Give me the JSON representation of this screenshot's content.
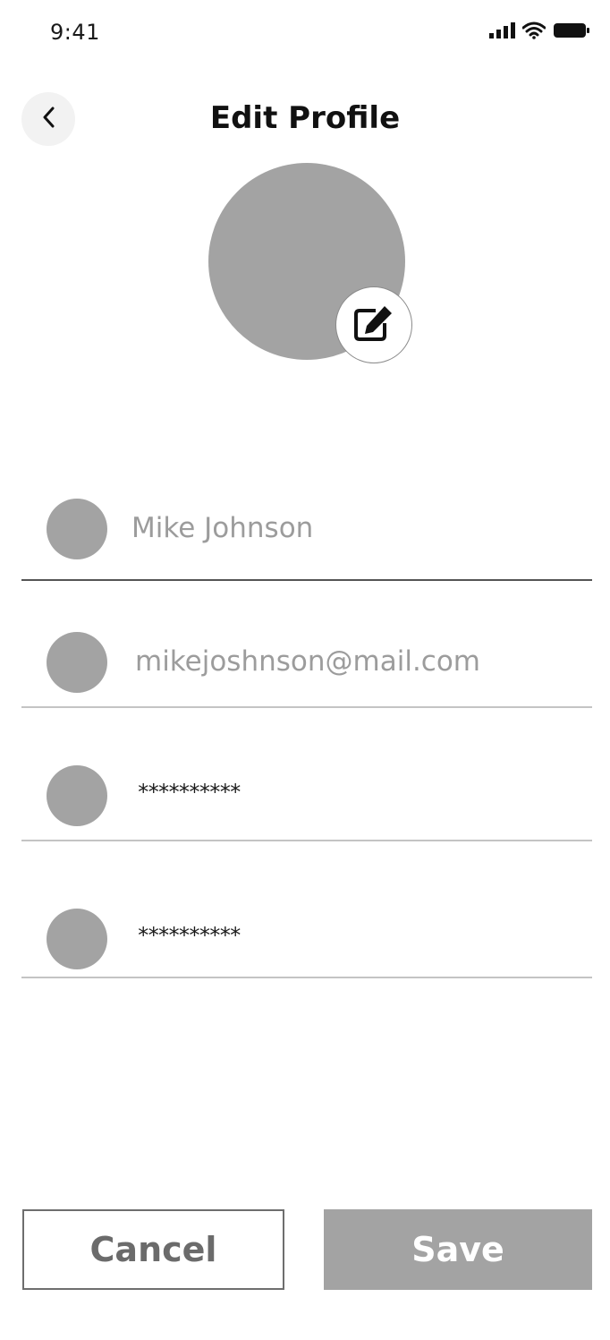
{
  "status_bar": {
    "time": "9:41",
    "icons": [
      "signal-icon",
      "wifi-icon",
      "battery-icon"
    ]
  },
  "header": {
    "back_icon": "chevron-left-icon",
    "title": "Edit Profile"
  },
  "avatar": {
    "edit_icon": "edit-icon"
  },
  "form": {
    "fields": [
      {
        "icon": "name-icon",
        "value": "Mike Johnson"
      },
      {
        "icon": "email-icon",
        "value": "mikejoshnson@mail.com"
      },
      {
        "icon": "password-icon",
        "value": "**********"
      },
      {
        "icon": "confirm-password-icon",
        "value": "**********"
      }
    ]
  },
  "actions": {
    "cancel_label": "Cancel",
    "save_label": "Save"
  },
  "colors": {
    "placeholder_gray": "#a3a3a3",
    "text_dark": "#111111",
    "muted_text": "#9c9c9c"
  }
}
